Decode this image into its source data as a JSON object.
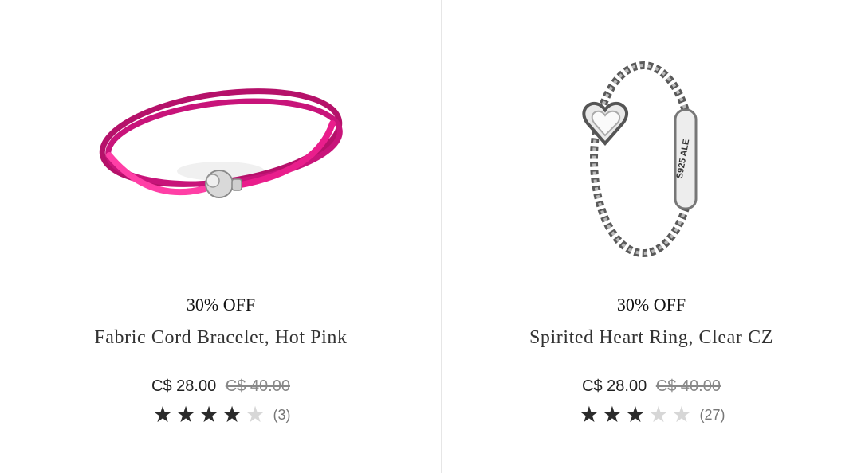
{
  "colors": {
    "cord_pink": "#ec1e8b",
    "silver": "#c8c8c8",
    "star_filled": "#2b2b2b",
    "star_empty": "#d7d7d7",
    "divider": "#e6e6e6"
  },
  "products": [
    {
      "image_icon": "bracelet-icon",
      "discount": "30% OFF",
      "name": "Fabric Cord Bracelet, Hot Pink",
      "price_now": "C$ 28.00",
      "price_was": "C$ 40.00",
      "rating": 4,
      "rating_max": 5,
      "review_count": "(3)"
    },
    {
      "image_icon": "ring-icon",
      "discount": "30% OFF",
      "name": "Spirited Heart Ring, Clear CZ",
      "price_now": "C$ 28.00",
      "price_was": "C$ 40.00",
      "rating": 3,
      "rating_max": 5,
      "review_count": "(27)",
      "engraving": "S925 ALE"
    }
  ]
}
